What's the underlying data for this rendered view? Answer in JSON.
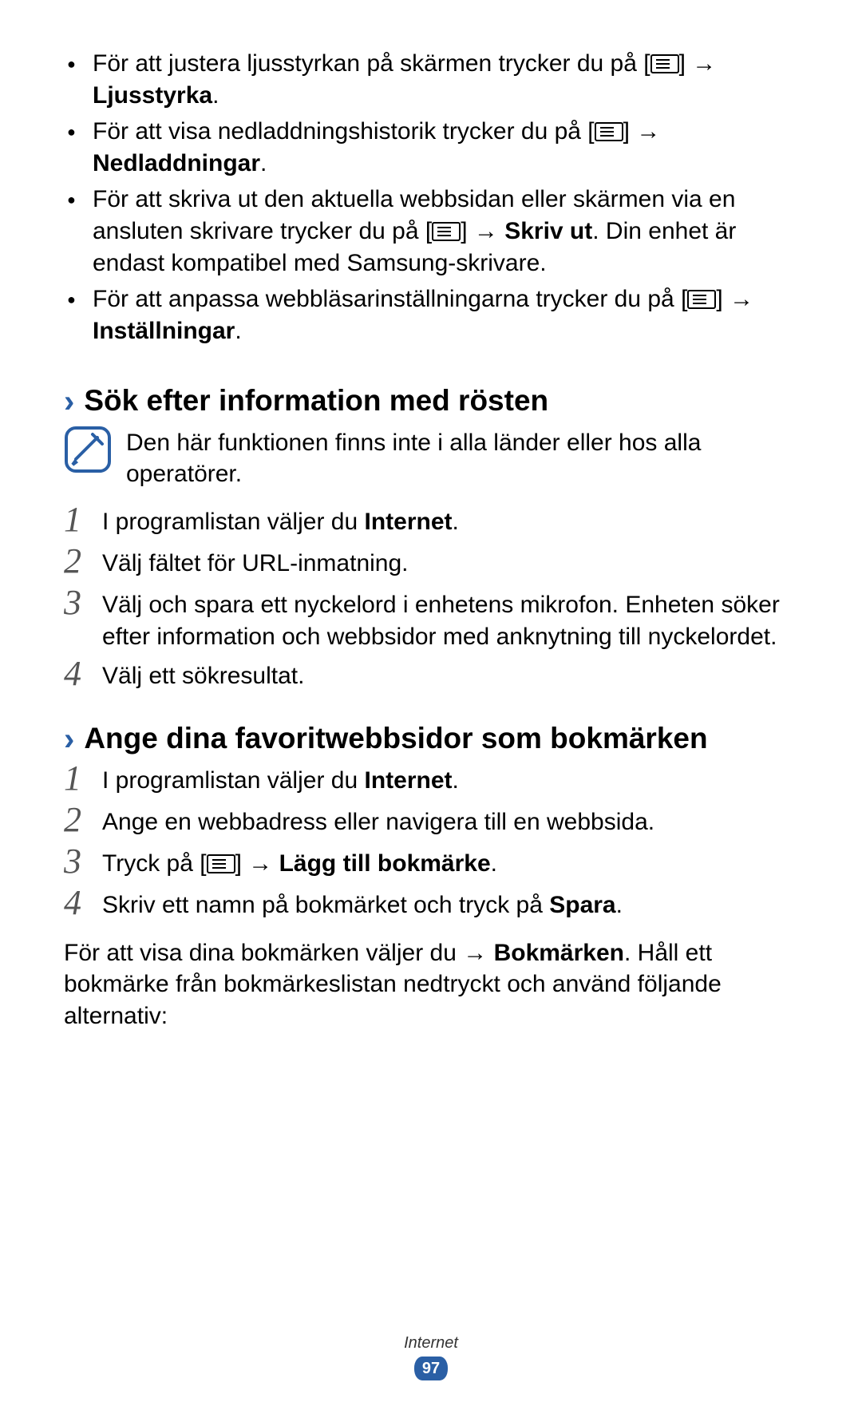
{
  "bullets": [
    {
      "pre": "För att justera ljusstyrkan på skärmen trycker du på [",
      "post_icon": "] ",
      "arrow": "→",
      "after_arrow": " ",
      "bold": "Ljusstyrka",
      "tail": "."
    },
    {
      "pre": "För att visa nedladdningshistorik trycker du på [",
      "post_icon": "] ",
      "arrow": "→",
      "after_arrow": " ",
      "bold": "Nedladdningar",
      "tail": "."
    },
    {
      "pre": "För att skriva ut den aktuella webbsidan eller skärmen via en ansluten skrivare trycker du på [",
      "post_icon": "] ",
      "arrow": "→",
      "after_arrow": " ",
      "bold": "Skriv ut",
      "tail": ". Din enhet är endast kompatibel med Samsung-skrivare."
    },
    {
      "pre": "För att anpassa webbläsarinställningarna trycker du på [",
      "post_icon": "] ",
      "arrow": "→",
      "after_arrow": " ",
      "bold": "Inställningar",
      "tail": "."
    }
  ],
  "section1": {
    "title": "Sök efter information med rösten",
    "note": "Den här funktionen finns inte i alla länder eller hos alla operatörer.",
    "steps": [
      {
        "t1": "I programlistan väljer du ",
        "b": "Internet",
        "t2": "."
      },
      {
        "t1": "Välj fältet för URL-inmatning.",
        "b": "",
        "t2": ""
      },
      {
        "t1": "Välj     och spara ett nyckelord i enhetens mikrofon. Enheten söker efter information och webbsidor med anknytning till nyckelordet.",
        "b": "",
        "t2": ""
      },
      {
        "t1": "Välj ett sökresultat.",
        "b": "",
        "t2": ""
      }
    ]
  },
  "section2": {
    "title": "Ange dina favoritwebbsidor som bokmärken",
    "steps": [
      {
        "t1": "I programlistan väljer du ",
        "b": "Internet",
        "t2": "."
      },
      {
        "t1": "Ange en webbadress eller navigera till en webbsida.",
        "b": "",
        "t2": ""
      },
      {
        "t1": "Tryck på [",
        "icon": true,
        "t1b": "] ",
        "arrow": "→",
        "t1c": " ",
        "b": "Lägg till bokmärke",
        "t2": "."
      },
      {
        "t1": "Skriv ett namn på bokmärket och tryck på ",
        "b": "Spara",
        "t2": "."
      }
    ],
    "para": {
      "t1": "För att visa dina bokmärken väljer du     ",
      "arrow": "→",
      "t2": " ",
      "b": "Bokmärken",
      "t3": ". Håll ett bokmärke från bokmärkeslistan nedtryckt och använd följande alternativ:"
    }
  },
  "footer": {
    "label": "Internet",
    "page": "97"
  },
  "glyphs": {
    "chevron": "›"
  }
}
